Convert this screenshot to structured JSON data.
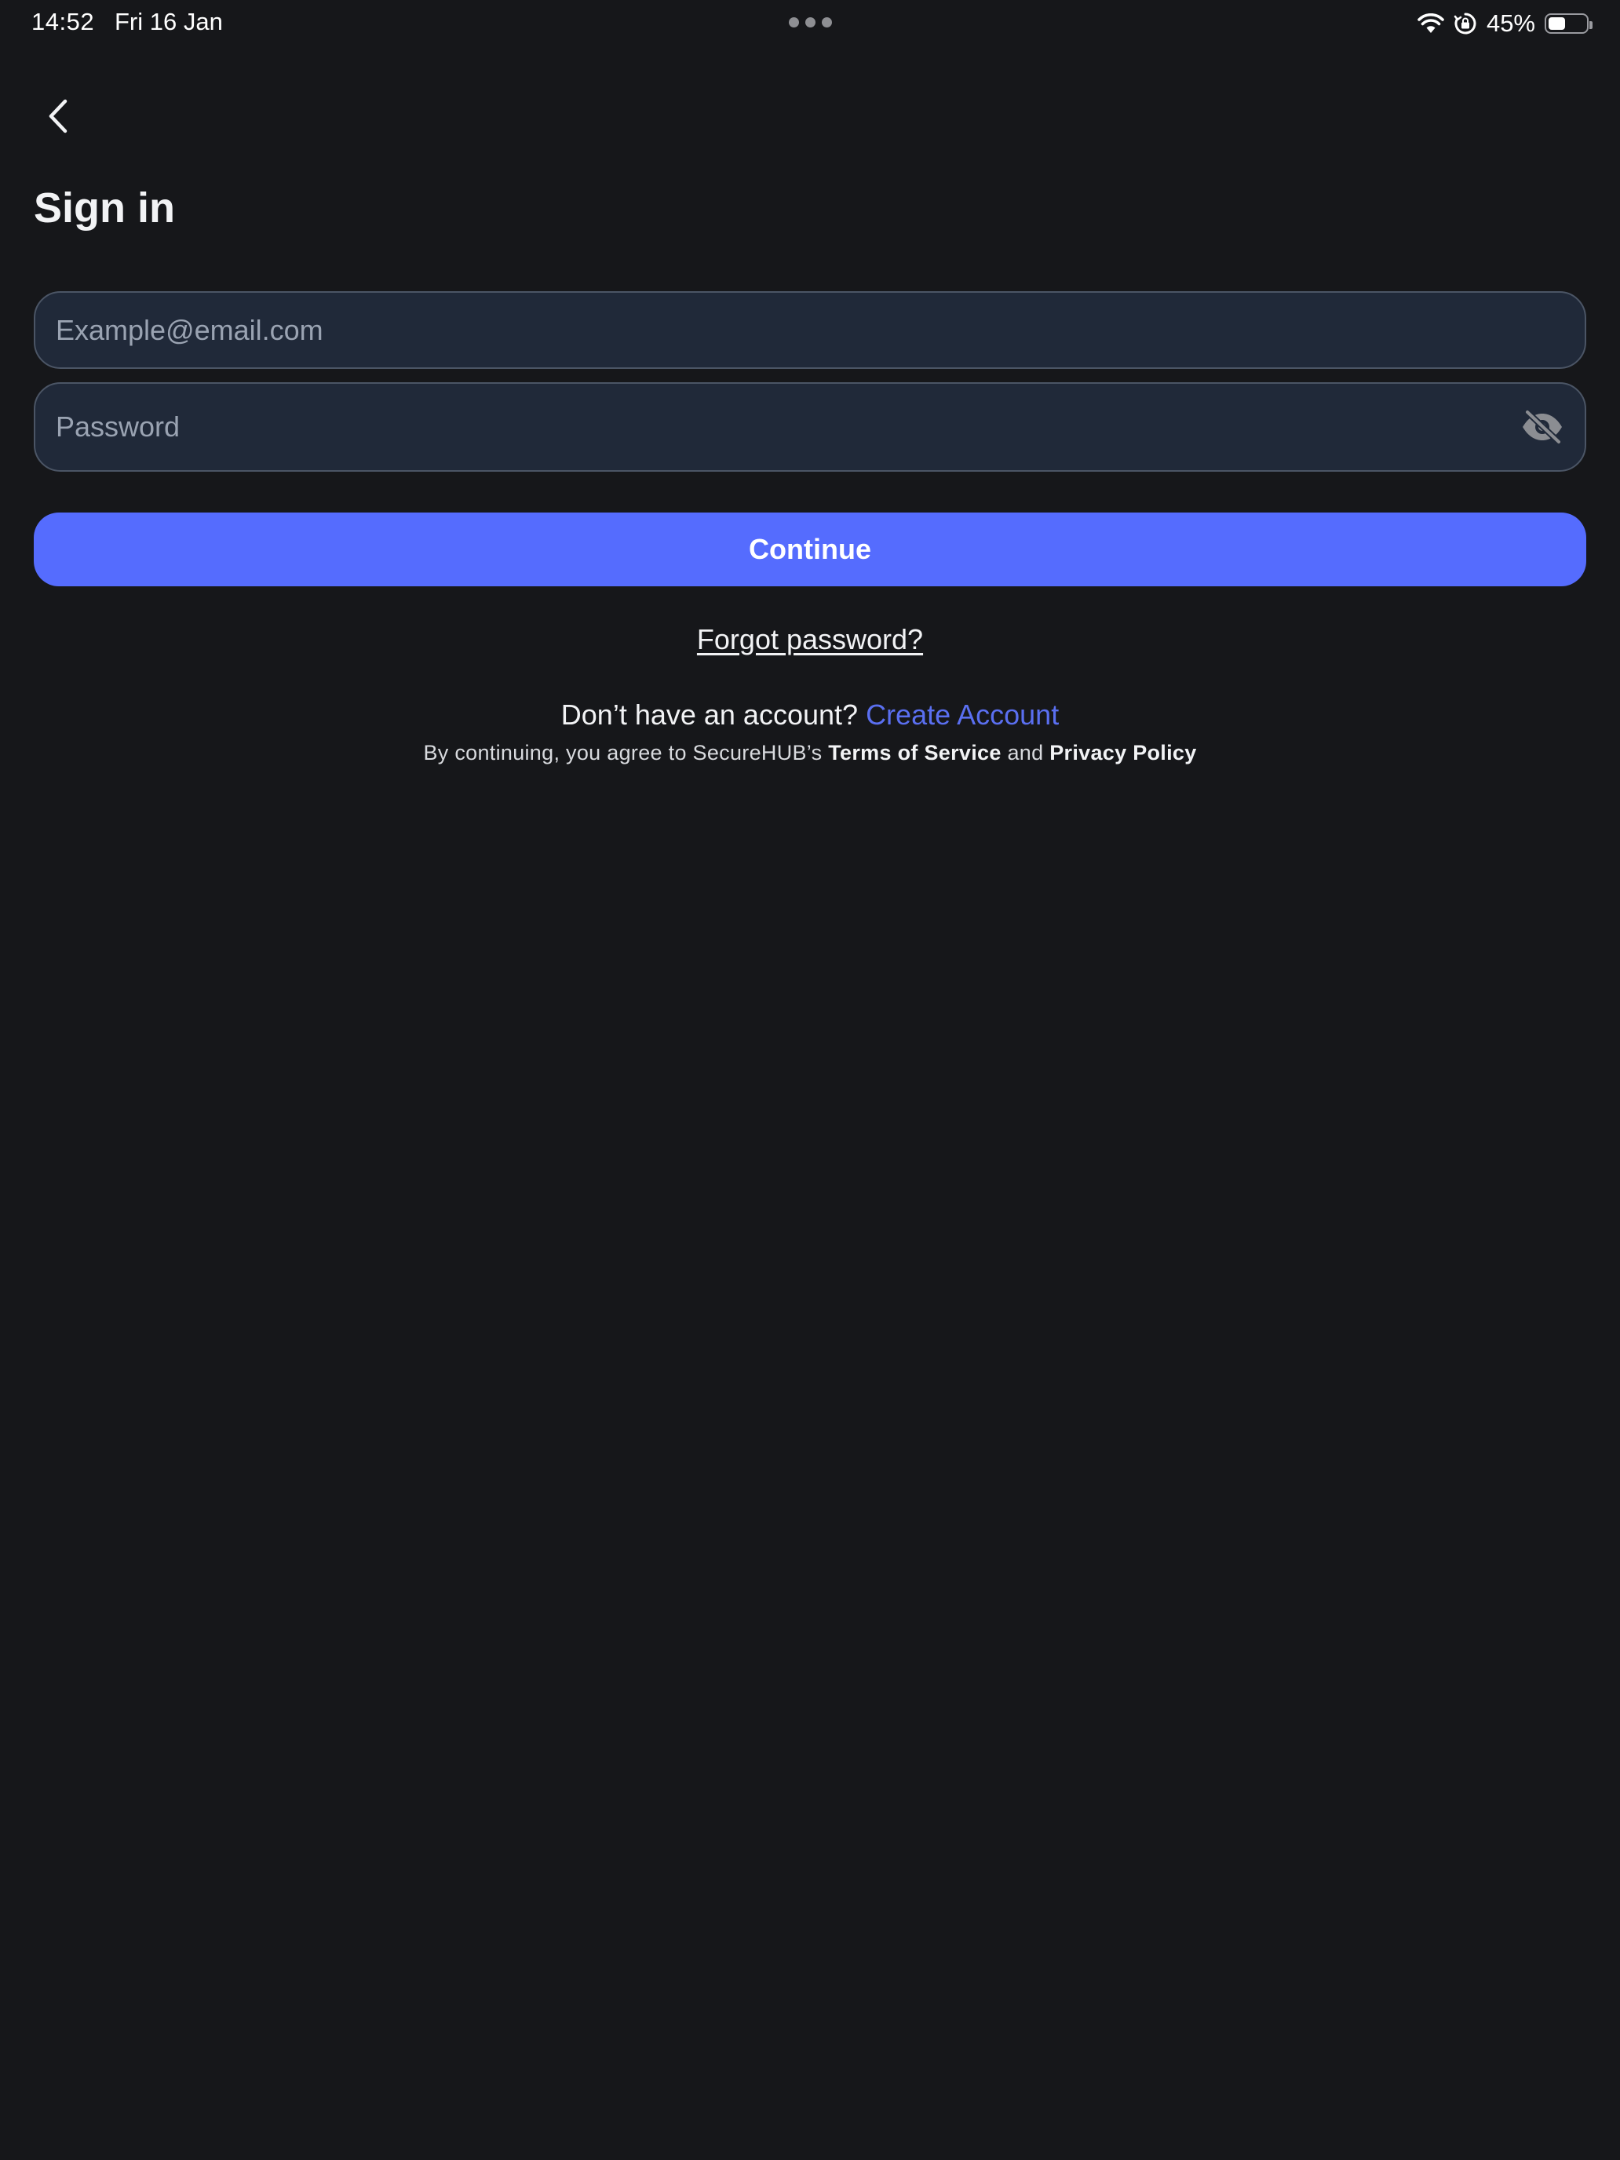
{
  "status_bar": {
    "time": "14:52",
    "date": "Fri 16 Jan",
    "battery_percent": "45%",
    "battery_level": 0.45
  },
  "header": {
    "back_icon": "chevron-left-icon",
    "title": "Sign in"
  },
  "form": {
    "email_placeholder": "Example@email.com",
    "email_value": "",
    "password_placeholder": "Password",
    "password_value": "",
    "password_toggle_icon": "eye-slash-icon",
    "continue_label": "Continue"
  },
  "links": {
    "forgot_password": "Forgot password?",
    "no_account_text": "Don’t have an account?",
    "create_account": "Create Account"
  },
  "legal": {
    "prefix": "By continuing, you agree to SecureHUB’s",
    "terms": "Terms of Service",
    "and": "and",
    "privacy": "Privacy Policy"
  },
  "colors": {
    "background": "#16171a",
    "field_background": "#202939",
    "field_border": "#4b5565",
    "accent": "#556cfe",
    "link_accent": "#5a6ff0"
  }
}
